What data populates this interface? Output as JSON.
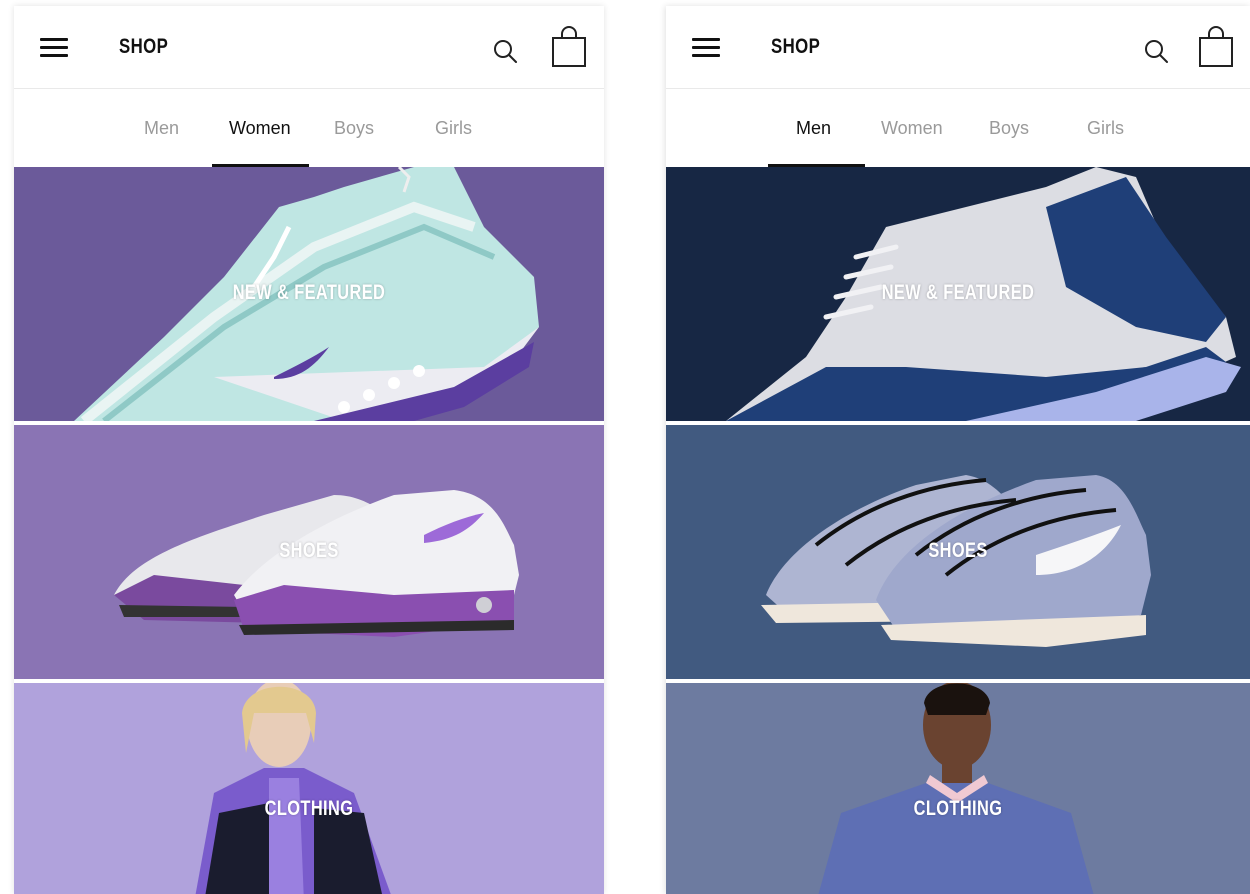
{
  "screens": [
    {
      "header": {
        "title": "SHOP"
      },
      "tabs": [
        {
          "label": "Men",
          "active": false
        },
        {
          "label": "Women",
          "active": true
        },
        {
          "label": "Boys",
          "active": false
        },
        {
          "label": "Girls",
          "active": false
        }
      ],
      "tiles": [
        {
          "label": "NEW & FEATURED",
          "background": "#6b5a9a"
        },
        {
          "label": "SHOES",
          "background": "#8a74b4"
        },
        {
          "label": "CLOTHING",
          "background": "#b0a2dc"
        }
      ]
    },
    {
      "header": {
        "title": "SHOP"
      },
      "tabs": [
        {
          "label": "Men",
          "active": true
        },
        {
          "label": "Women",
          "active": false
        },
        {
          "label": "Boys",
          "active": false
        },
        {
          "label": "Girls",
          "active": false
        }
      ],
      "tiles": [
        {
          "label": "NEW & FEATURED",
          "background": "#172744"
        },
        {
          "label": "SHOES",
          "background": "#415a80"
        },
        {
          "label": "CLOTHING",
          "background": "#6d7ba0"
        }
      ]
    }
  ],
  "icons": [
    "menu-icon",
    "search-icon",
    "shopping-bag-icon"
  ]
}
